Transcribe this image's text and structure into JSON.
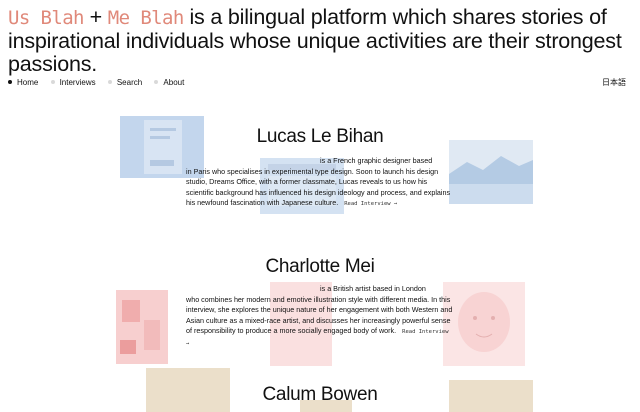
{
  "header": {
    "brand_a": "Us Blah",
    "plus": "+",
    "brand_b": "Me Blah",
    "tagline": "is a bilingual platform which shares stories of inspirational individuals whose unique activities are their strongest passions."
  },
  "nav": {
    "items": [
      {
        "label": "Home",
        "active": true
      },
      {
        "label": "Interviews",
        "active": false
      },
      {
        "label": "Search",
        "active": false
      },
      {
        "label": "About",
        "active": false
      }
    ],
    "language": "日本語"
  },
  "interviews": [
    {
      "name": "Lucas Le Bihan",
      "summary_first": "is a French graphic designer based",
      "summary_rest": "in Paris who specialises in experimental type design. Soon to launch his design studio, Dreams Office, with a former classmate, Lucas reveals to us how his scientific background has influenced his design ideology and process, and explains his newfound fascination with Japanese culture.",
      "read_label": "Read Interview →"
    },
    {
      "name": "Charlotte Mei",
      "summary_first": "is a British artist based in London",
      "summary_rest": "who combines her modern and emotive illustration style with different media. In this interview, she explores the unique nature of her engagement with both Western and Asian culture as a mixed-race artist, and discusses her increasingly powerful sense of responsibility to produce a more socially engaged body of work.",
      "read_label": "Read Interview →"
    },
    {
      "name": "Calum Bowen",
      "summary_first": "",
      "summary_rest": "",
      "read_label": ""
    }
  ],
  "colors": {
    "brand": "#e0897a",
    "thumb_blue": "#b9cfea",
    "thumb_pink": "#f6c7c7",
    "thumb_sand": "#e9dcc4"
  }
}
